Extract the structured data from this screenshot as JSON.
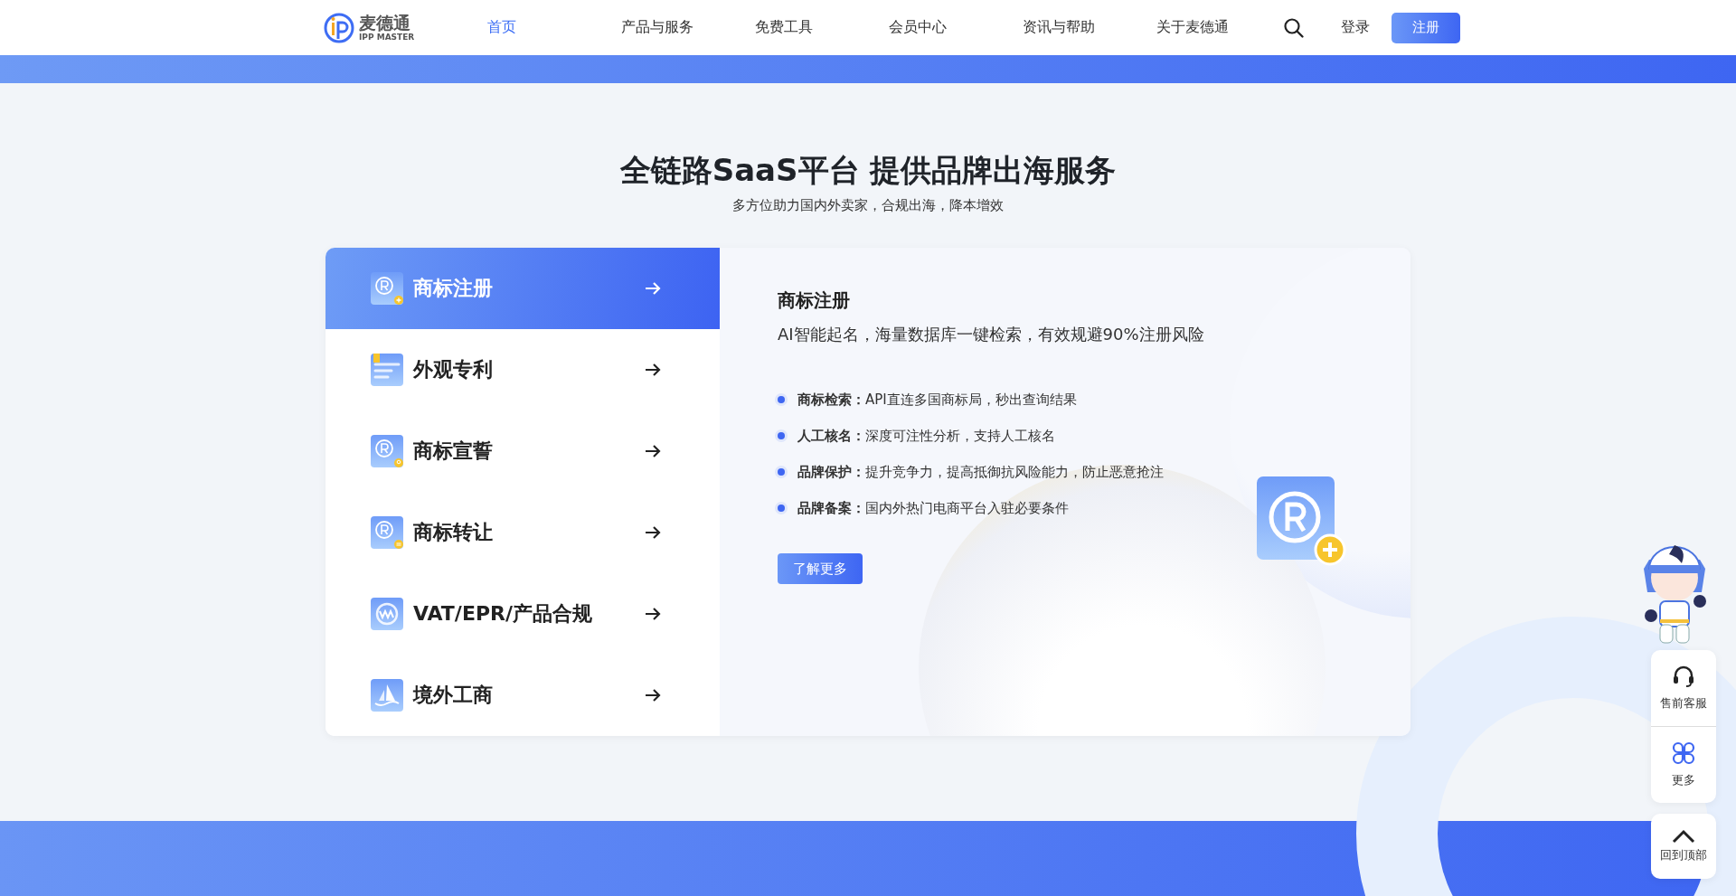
{
  "header": {
    "logo": {
      "name": "麦德通",
      "sub": "IPP MASTER"
    },
    "nav": [
      {
        "label": "首页",
        "selected": true
      },
      {
        "label": "产品与服务",
        "selected": false
      },
      {
        "label": "免费工具",
        "selected": false
      },
      {
        "label": "会员中心",
        "selected": false
      },
      {
        "label": "资讯与帮助",
        "selected": false
      },
      {
        "label": "关于麦德通",
        "selected": false
      }
    ],
    "login": "登录",
    "register": "注册"
  },
  "section": {
    "title": "全链路SaaS平台 提供品牌出海服务",
    "subtitle": "多方位助力国内外卖家，合规出海，降本增效"
  },
  "menu": [
    {
      "label": "商标注册",
      "kind": "register",
      "selected": true
    },
    {
      "label": "外观专利",
      "kind": "patent",
      "selected": false
    },
    {
      "label": "商标宣誓",
      "kind": "oath",
      "selected": false
    },
    {
      "label": "商标转让",
      "kind": "transfer",
      "selected": false
    },
    {
      "label": "VAT/EPR/产品合规",
      "kind": "vat",
      "selected": false
    },
    {
      "label": "境外工商",
      "kind": "overseas",
      "selected": false
    }
  ],
  "detail": {
    "title": "商标注册",
    "description": "AI智能起名，海量数据库一键检索，有效规避90%注册风险",
    "features": [
      {
        "name": "商标检索：",
        "text": "API直连多国商标局，秒出查询结果"
      },
      {
        "name": "人工核名：",
        "text": "深度可注性分析，支持人工核名"
      },
      {
        "name": "品牌保护：",
        "text": "提升竞争力，提高抵御抗风险能力，防止恶意抢注"
      },
      {
        "name": "品牌备案：",
        "text": "国内外热门电商平台入驻必要条件"
      }
    ],
    "button": "了解更多"
  },
  "floating": {
    "items": [
      {
        "label": "售前客服",
        "kind": "headset"
      },
      {
        "label": "更多",
        "kind": "more"
      }
    ],
    "top": "回到顶部"
  }
}
